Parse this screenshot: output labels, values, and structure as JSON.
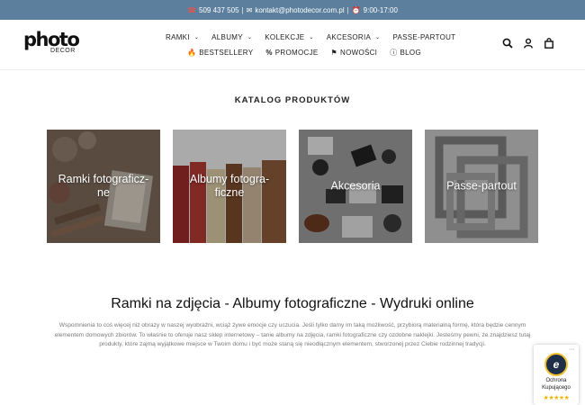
{
  "topbar": {
    "phone": "509 437 505",
    "email": "kontakt@photodecor.com.pl",
    "hours": "9:00-17:00",
    "separator": "|"
  },
  "logo": {
    "main": "photo",
    "sub": "DECOR"
  },
  "nav": {
    "primary": [
      "RAMKI",
      "ALBUMY",
      "KOLEKCJE",
      "AKCESORIA",
      "PASSE-PARTOUT"
    ],
    "secondary": [
      "BESTSELLERY",
      "PROMOCJE",
      "NOWOŚCI",
      "BLOG"
    ]
  },
  "header_icons": [
    "search-icon",
    "account-icon",
    "cart-icon"
  ],
  "catalog": {
    "title": "KATALOG PRODUKTÓW",
    "tiles": [
      "Ramki fotograficz-ne",
      "Albumy fotogra-ficzne",
      "Akcesoria",
      "Passe-partout"
    ]
  },
  "main": {
    "heading": "Ramki na zdjęcia - Albumy fotograficzne - Wydruki online",
    "intro": "Wspomnienia to coś więcej niż obrazy w naszej wyobraźni, wciąż żywe emocje czy uczucia. Jeśli tylko damy im taką możliwość, przybiorą materialną formę, która będzie cennym elementem domowych zbiorów. To właśnie to oferuje nasz sklep internetowy – tanie albumy na zdjęcia, ramki fotograficzne czy ozdobne naklejki. Jesteśmy pewni, że znajdziesz tutaj produkty, które zajmą wyjątkowe miejsce w Twoim domu i być może staną się nieodłącznym elementem, stworzonej przez Ciebie rodzinnej tradycji."
  },
  "badge": {
    "line1": "Ochrona",
    "line2": "Kupującego",
    "stars": "★★★★★",
    "seal": "e",
    "menu": "···"
  },
  "colors": {
    "topbar": "#5b7f9c",
    "star": "#f2b300"
  }
}
